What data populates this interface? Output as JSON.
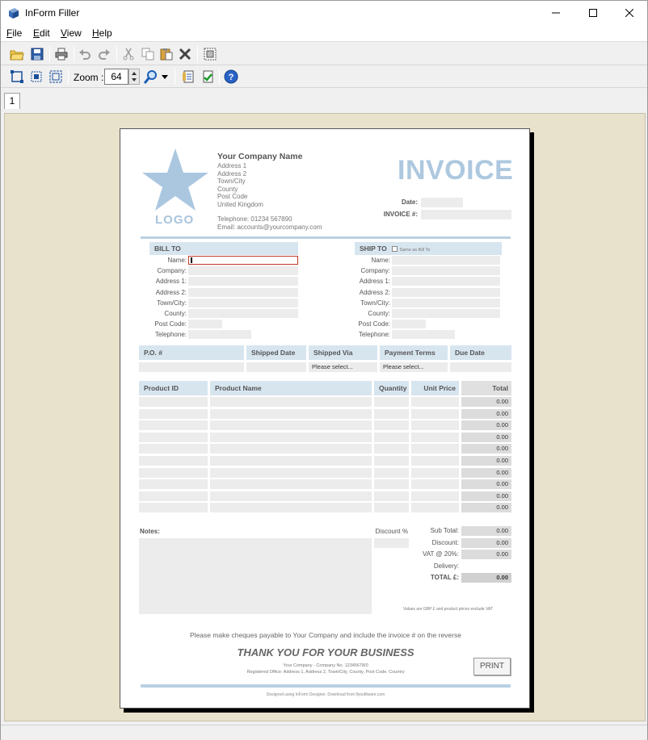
{
  "window": {
    "title": "InForm Filler"
  },
  "menu": [
    {
      "label": "File",
      "accel": "F",
      "rest": "ile"
    },
    {
      "label": "Edit",
      "accel": "E",
      "rest": "dit"
    },
    {
      "label": "View",
      "accel": "V",
      "rest": "iew"
    },
    {
      "label": "Help",
      "accel": "H",
      "rest": "elp"
    }
  ],
  "toolbar": {
    "zoom_label": "Zoom :",
    "zoom_value": "64",
    "icons": [
      "open-icon",
      "save-icon",
      "print-icon",
      "undo-icon",
      "redo-icon",
      "cut-icon",
      "copy-icon",
      "paste-icon",
      "delete-icon",
      "select-all-icon"
    ],
    "icons2": [
      "fit-page-icon",
      "fit-width-icon",
      "actual-size-icon",
      "zoom-icon",
      "dropdown-icon",
      "properties-icon",
      "validate-icon",
      "help-icon"
    ]
  },
  "page_tab": "1",
  "invoice": {
    "company": {
      "name": "Your Company Name",
      "lines": [
        "Address 1",
        "Address 2",
        "Town/City",
        "County",
        "Post Code",
        "United Kingdom"
      ],
      "telephone": "Telephone: 01234 567890",
      "email": "Email: accounts@yourcompany.com"
    },
    "logo": "LOGO",
    "title": "INVOICE",
    "date_label": "Date:",
    "invoice_no_label": "INVOICE #:",
    "bill_to": {
      "header": "BILL TO",
      "fields": [
        "Name:",
        "Company:",
        "Address 1:",
        "Address 2:",
        "Town/City:",
        "County:",
        "Post Code:",
        "Telephone:"
      ]
    },
    "ship_to": {
      "header": "SHIP TO",
      "same_as": "Same as Bill To",
      "fields": [
        "Name:",
        "Company:",
        "Address 1:",
        "Address 2:",
        "Town/City:",
        "County:",
        "Post Code:",
        "Telephone:"
      ]
    },
    "order_headers": [
      "P.O. #",
      "Shipped Date",
      "Shipped Via",
      "Payment Terms",
      "Due Date"
    ],
    "order_values": [
      "",
      "",
      "Please select...",
      "Please select...",
      ""
    ],
    "items_headers": [
      "Product ID",
      "Product Name",
      "Quantity",
      "Unit Price",
      "Total"
    ],
    "item_totals": [
      "0.00",
      "0.00",
      "0.00",
      "0.00",
      "0.00",
      "0.00",
      "0.00",
      "0.00",
      "0.00",
      "0.00"
    ],
    "notes_label": "Notes:",
    "discount_pct_label": "Discount %",
    "summary": [
      {
        "label": "Sub Total:",
        "value": "0.00"
      },
      {
        "label": "Discount:",
        "value": "0.00"
      },
      {
        "label": "VAT @ 20%:",
        "value": "0.00"
      },
      {
        "label": "Delivery:",
        "value": ""
      },
      {
        "label": "TOTAL £:",
        "value": "0.00"
      }
    ],
    "values_note": "Values are GBP £ and product prices exclude VAT",
    "cheque_note": "Please make cheques payable to Your Company and include the invoice # on the reverse",
    "thanks": "THANK YOU FOR YOUR BUSINESS",
    "footer1": "Your Company - Company No. 12345678/0",
    "footer2": "Registered Office: Address 1, Address 2, Town/City, County, Post Code, Country",
    "print_label": "PRINT",
    "designed": "Designed using InForm Designer.  Download from flyoufilware.com"
  }
}
